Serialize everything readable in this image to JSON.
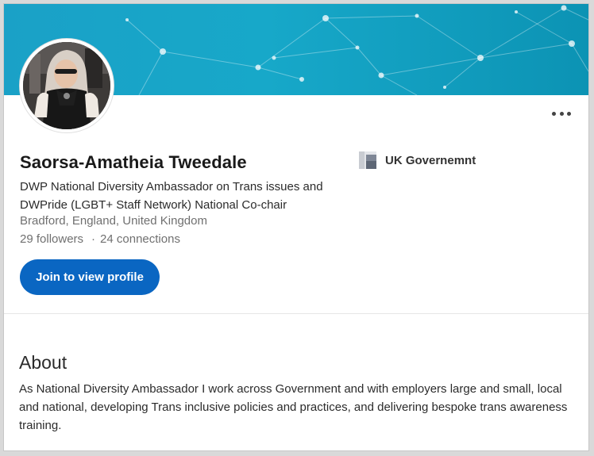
{
  "profile": {
    "name": "Saorsa-Amatheia Tweedale",
    "headline": "DWP National Diversity Ambassador on Trans issues and DWPride (LGBT+ Staff Network) National Co-chair",
    "location": "Bradford, England, United Kingdom",
    "followers": "29 followers",
    "separator": "·",
    "connections": "24 connections",
    "join_label": "Join to view profile",
    "organization": "UK Governemnt"
  },
  "about": {
    "title": "About",
    "text": "As National Diversity Ambassador I work across Government and with employers large and small, local and national, developing Trans inclusive policies and practices, and delivering bespoke trans awareness training."
  },
  "icons": {
    "more": "more-options-icon",
    "org_logo": "organization-logo-icon"
  },
  "colors": {
    "accent": "#0a66c2",
    "banner": "#17a8c9"
  }
}
